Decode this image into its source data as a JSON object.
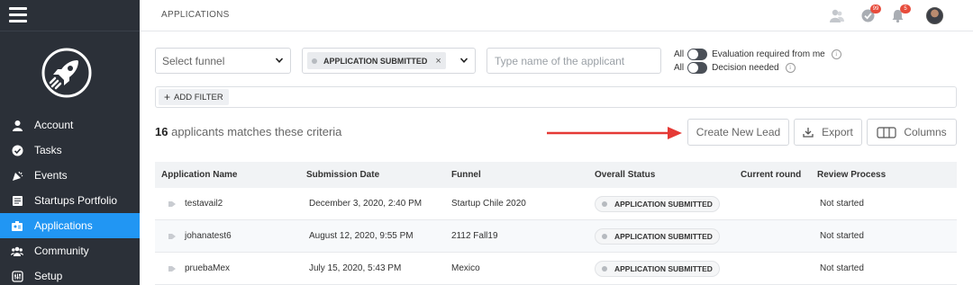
{
  "sidebar": {
    "items": [
      {
        "label": "Account",
        "icon": "user-icon"
      },
      {
        "label": "Tasks",
        "icon": "check-circle-icon"
      },
      {
        "label": "Events",
        "icon": "party-icon"
      },
      {
        "label": "Startups Portfolio",
        "icon": "portfolio-icon"
      },
      {
        "label": "Applications",
        "icon": "applications-icon",
        "active": true
      },
      {
        "label": "Community",
        "icon": "community-icon"
      },
      {
        "label": "Setup",
        "icon": "setup-icon"
      }
    ],
    "active_color": "#2196f3",
    "background": "#2b3038"
  },
  "header": {
    "title": "APPLICATIONS",
    "tasks_badge": "99",
    "notifications_badge": "5"
  },
  "filters": {
    "funnel_placeholder": "Select funnel",
    "status_chip": "APPLICATION SUBMITTED",
    "status_chip_remove": "×",
    "applicant_placeholder": "Type name of the applicant",
    "toggles": [
      {
        "prefix": "All",
        "label": "Evaluation required from me",
        "info": "i"
      },
      {
        "prefix": "All",
        "label": "Decision needed",
        "info": "i"
      }
    ],
    "add_filter_label": "ADD FILTER"
  },
  "results": {
    "count": "16",
    "suffix": "applicants matches these criteria"
  },
  "actions": {
    "create_lead": "Create New Lead",
    "export": "Export",
    "columns": "Columns"
  },
  "table": {
    "headers": [
      "Application Name",
      "Submission Date",
      "Funnel",
      "Overall Status",
      "Current round",
      "Review Process"
    ],
    "rows": [
      {
        "name": "testavail2",
        "date": "December 3, 2020, 2:40 PM",
        "funnel": "Startup Chile 2020",
        "status": "APPLICATION SUBMITTED",
        "round": "",
        "review": "Not started"
      },
      {
        "name": "johanatest6",
        "date": "August 12, 2020, 9:55 PM",
        "funnel": "2112 Fall19",
        "status": "APPLICATION SUBMITTED",
        "round": "",
        "review": "Not started"
      },
      {
        "name": "pruebaMex",
        "date": "July 15, 2020, 5:43 PM",
        "funnel": "Mexico",
        "status": "APPLICATION SUBMITTED",
        "round": "",
        "review": "Not started"
      }
    ]
  },
  "annotation_arrow_color": "#e53935"
}
